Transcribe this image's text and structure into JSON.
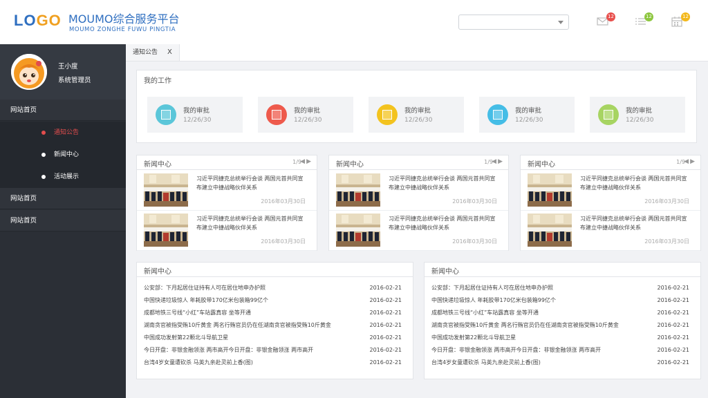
{
  "header": {
    "logo_part1": "LO",
    "logo_part2": "GO",
    "title": "MOUMO综合服务平台",
    "subtitle": "MOUMO ZONGHE FUWU PINGTIA",
    "select_value": "",
    "icons": [
      {
        "name": "mail-icon",
        "badge": "12",
        "color": "#e8504d"
      },
      {
        "name": "list-icon",
        "badge": "12",
        "color": "#8dc63f"
      },
      {
        "name": "calendar-icon",
        "badge": "12",
        "color": "#f3b81b"
      }
    ]
  },
  "sidebar": {
    "user_name": "王小度",
    "user_role": "系统管理员",
    "menu": [
      {
        "label": "网站首页"
      },
      {
        "label": "通知公告",
        "sub": true,
        "active": true
      },
      {
        "label": "新闻中心",
        "sub": true
      },
      {
        "label": "活动展示",
        "sub": true
      },
      {
        "label": "网站首页"
      },
      {
        "label": "网站首页"
      }
    ]
  },
  "tabs": [
    {
      "label": "通知公告",
      "close": "X"
    }
  ],
  "work": {
    "title": "我的工作",
    "cards": [
      {
        "label": "我的审批",
        "date": "12/26/30",
        "color": "#5bc6d9"
      },
      {
        "label": "我的审批",
        "date": "12/26/30",
        "color": "#ee5a4c"
      },
      {
        "label": "我的审批",
        "date": "12/26/30",
        "color": "#f3c31f"
      },
      {
        "label": "我的审批",
        "date": "12/26/30",
        "color": "#45bde6"
      },
      {
        "label": "我的审批",
        "date": "12/26/30",
        "color": "#a7d462"
      }
    ]
  },
  "news_panels": [
    {
      "title": "新闻中心",
      "pager": "1/9",
      "items": [
        {
          "text": "习近平同捷克总统举行会谈 两国元首共同宣布建立中捷战略伙伴关系",
          "date": "2016年03月30日"
        },
        {
          "text": "习近平同捷克总统举行会谈 两国元首共同宣布建立中捷战略伙伴关系",
          "date": "2016年03月30日"
        }
      ]
    },
    {
      "title": "新闻中心",
      "pager": "1/9",
      "items": [
        {
          "text": "习近平同捷克总统举行会谈 两国元首共同宣布建立中捷战略伙伴关系",
          "date": "2016年03月30日"
        },
        {
          "text": "习近平同捷克总统举行会谈 两国元首共同宣布建立中捷战略伙伴关系",
          "date": "2016年03月30日"
        }
      ]
    },
    {
      "title": "新闻中心",
      "pager": "1/9",
      "items": [
        {
          "text": "习近平同捷克总统举行会谈 两国元首共同宣布建立中捷战略伙伴关系",
          "date": "2016年03月30日"
        },
        {
          "text": "习近平同捷克总统举行会谈 两国元首共同宣布建立中捷战略伙伴关系",
          "date": "2016年03月30日"
        }
      ]
    }
  ],
  "list_panels": [
    {
      "title": "新闻中心",
      "rows": [
        {
          "text": "公安部：下月起居住证持有人可在居住地申办护照",
          "date": "2016-02-21"
        },
        {
          "text": "中国快递垃圾惊人 年耗胶带170亿米包装箱99亿个",
          "date": "2016-02-21"
        },
        {
          "text": "成都地铁三号线“小红”车站露真容 坐等开通",
          "date": "2016-02-21"
        },
        {
          "text": "湖南贪官被指受贿10斤黄金 两名行贿官员仍在任湖南贪官被指受贿10斤黄金",
          "date": "2016-02-21"
        },
        {
          "text": "中国成功发射第22颗北斗导航卫星",
          "date": "2016-02-21"
        },
        {
          "text": "今日开盘：非银金融领涨 两市高开今日开盘：非银金融领涨 两市高开",
          "date": "2016-02-21"
        },
        {
          "text": "台湾4岁女童遭砍杀 马英九亲赴灵前上香(图)",
          "date": "2016-02-21"
        }
      ]
    },
    {
      "title": "新闻中心",
      "rows": [
        {
          "text": "公安部：下月起居住证持有人可在居住地申办护照",
          "date": "2016-02-21"
        },
        {
          "text": "中国快递垃圾惊人 年耗胶带170亿米包装箱99亿个",
          "date": "2016-02-21"
        },
        {
          "text": "成都地铁三号线“小红”车站露真容 坐等开通",
          "date": "2016-02-21"
        },
        {
          "text": "湖南贪官被指受贿10斤黄金 两名行贿官员仍在任湖南贪官被指受贿10斤黄金",
          "date": "2016-02-21"
        },
        {
          "text": "中国成功发射第22颗北斗导航卫星",
          "date": "2016-02-21"
        },
        {
          "text": "今日开盘：非银金融领涨 两市高开今日开盘：非银金融领涨 两市高开",
          "date": "2016-02-21"
        },
        {
          "text": "台湾4岁女童遭砍杀 马英九亲赴灵前上香(图)",
          "date": "2016-02-21"
        }
      ]
    }
  ]
}
